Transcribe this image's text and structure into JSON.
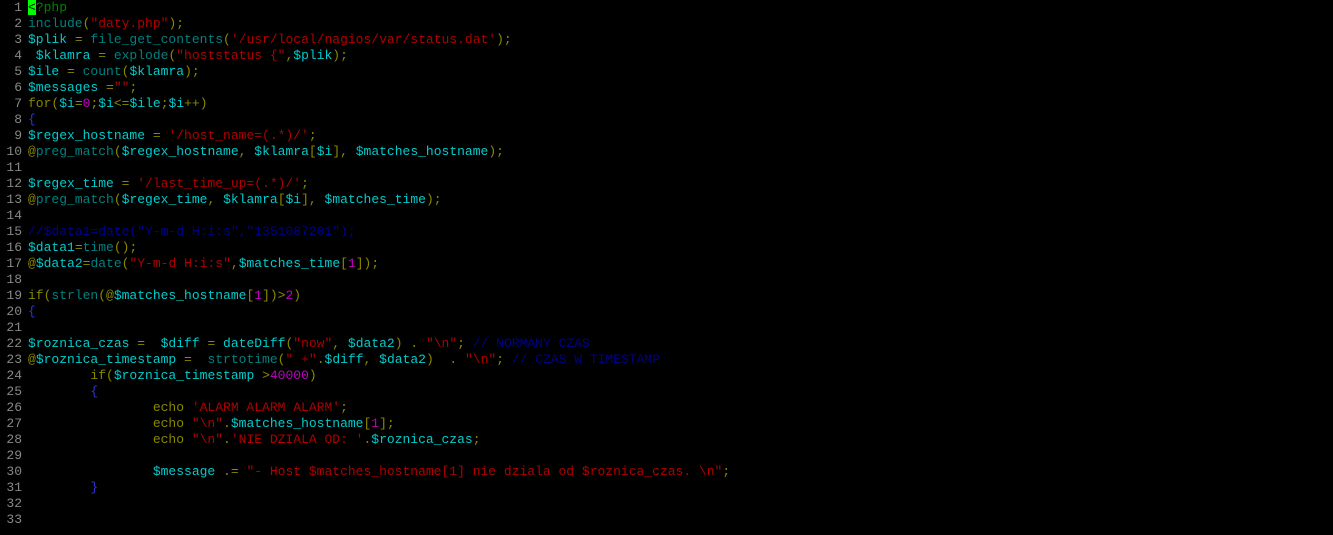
{
  "lines": [
    {
      "n": 1,
      "tokens": [
        {
          "cls": "cursor",
          "txt": "<"
        },
        {
          "cls": "tok-php",
          "txt": "?php"
        }
      ]
    },
    {
      "n": 2,
      "tokens": [
        {
          "cls": "tok-kw",
          "txt": "include"
        },
        {
          "cls": "tok-op",
          "txt": "("
        },
        {
          "cls": "tok-str",
          "txt": "\"daty.php\""
        },
        {
          "cls": "tok-op",
          "txt": ");"
        }
      ]
    },
    {
      "n": 3,
      "tokens": [
        {
          "cls": "tok-var",
          "txt": "$plik "
        },
        {
          "cls": "tok-op",
          "txt": "= "
        },
        {
          "cls": "tok-kw",
          "txt": "file_get_contents"
        },
        {
          "cls": "tok-op",
          "txt": "("
        },
        {
          "cls": "tok-str",
          "txt": "'/usr/local/nagios/var/status.dat'"
        },
        {
          "cls": "tok-op",
          "txt": ");"
        }
      ]
    },
    {
      "n": 4,
      "tokens": [
        {
          "cls": "tok-var",
          "txt": " $klamra "
        },
        {
          "cls": "tok-op",
          "txt": "= "
        },
        {
          "cls": "tok-kw",
          "txt": "explode"
        },
        {
          "cls": "tok-op",
          "txt": "("
        },
        {
          "cls": "tok-str",
          "txt": "\"hoststatus {\""
        },
        {
          "cls": "tok-op",
          "txt": ","
        },
        {
          "cls": "tok-var",
          "txt": "$plik"
        },
        {
          "cls": "tok-op",
          "txt": ");"
        }
      ]
    },
    {
      "n": 5,
      "tokens": [
        {
          "cls": "tok-var",
          "txt": "$ile "
        },
        {
          "cls": "tok-op",
          "txt": "= "
        },
        {
          "cls": "tok-kw",
          "txt": "count"
        },
        {
          "cls": "tok-op",
          "txt": "("
        },
        {
          "cls": "tok-var",
          "txt": "$klamra"
        },
        {
          "cls": "tok-op",
          "txt": ");"
        }
      ]
    },
    {
      "n": 6,
      "tokens": [
        {
          "cls": "tok-var",
          "txt": "$messages "
        },
        {
          "cls": "tok-op",
          "txt": "="
        },
        {
          "cls": "tok-str",
          "txt": "\"\""
        },
        {
          "cls": "tok-op",
          "txt": ";"
        }
      ]
    },
    {
      "n": 7,
      "tokens": [
        {
          "cls": "tok-op",
          "txt": "for("
        },
        {
          "cls": "tok-var",
          "txt": "$i"
        },
        {
          "cls": "tok-op",
          "txt": "="
        },
        {
          "cls": "tok-num",
          "txt": "0"
        },
        {
          "cls": "tok-op",
          "txt": ";"
        },
        {
          "cls": "tok-var",
          "txt": "$i"
        },
        {
          "cls": "tok-op",
          "txt": "<="
        },
        {
          "cls": "tok-var",
          "txt": "$ile"
        },
        {
          "cls": "tok-op",
          "txt": ";"
        },
        {
          "cls": "tok-var",
          "txt": "$i"
        },
        {
          "cls": "tok-op",
          "txt": "++)"
        }
      ]
    },
    {
      "n": 8,
      "tokens": [
        {
          "cls": "tok-brace",
          "txt": "{"
        }
      ]
    },
    {
      "n": 9,
      "tokens": [
        {
          "cls": "tok-var",
          "txt": "$regex_hostname "
        },
        {
          "cls": "tok-op",
          "txt": "= "
        },
        {
          "cls": "tok-str",
          "txt": "'/host_name=(.*)/'"
        },
        {
          "cls": "tok-op",
          "txt": ";"
        }
      ]
    },
    {
      "n": 10,
      "tokens": [
        {
          "cls": "tok-op",
          "txt": "@"
        },
        {
          "cls": "tok-kw",
          "txt": "preg_match"
        },
        {
          "cls": "tok-op",
          "txt": "("
        },
        {
          "cls": "tok-var",
          "txt": "$regex_hostname"
        },
        {
          "cls": "tok-op",
          "txt": ", "
        },
        {
          "cls": "tok-var",
          "txt": "$klamra"
        },
        {
          "cls": "tok-op",
          "txt": "["
        },
        {
          "cls": "tok-var",
          "txt": "$i"
        },
        {
          "cls": "tok-op",
          "txt": "], "
        },
        {
          "cls": "tok-var",
          "txt": "$matches_hostname"
        },
        {
          "cls": "tok-op",
          "txt": ");"
        }
      ]
    },
    {
      "n": 11,
      "tokens": []
    },
    {
      "n": 12,
      "tokens": [
        {
          "cls": "tok-var",
          "txt": "$regex_time "
        },
        {
          "cls": "tok-op",
          "txt": "= "
        },
        {
          "cls": "tok-str",
          "txt": "'/last_time_up=(.*)/'"
        },
        {
          "cls": "tok-op",
          "txt": ";"
        }
      ]
    },
    {
      "n": 13,
      "tokens": [
        {
          "cls": "tok-op",
          "txt": "@"
        },
        {
          "cls": "tok-kw",
          "txt": "preg_match"
        },
        {
          "cls": "tok-op",
          "txt": "("
        },
        {
          "cls": "tok-var",
          "txt": "$regex_time"
        },
        {
          "cls": "tok-op",
          "txt": ", "
        },
        {
          "cls": "tok-var",
          "txt": "$klamra"
        },
        {
          "cls": "tok-op",
          "txt": "["
        },
        {
          "cls": "tok-var",
          "txt": "$i"
        },
        {
          "cls": "tok-op",
          "txt": "], "
        },
        {
          "cls": "tok-var",
          "txt": "$matches_time"
        },
        {
          "cls": "tok-op",
          "txt": ");"
        }
      ]
    },
    {
      "n": 14,
      "tokens": []
    },
    {
      "n": 15,
      "tokens": [
        {
          "cls": "tok-comment",
          "txt": "//$data1=date(\"Y-m-d H:i:s\",\"1351087201\");"
        }
      ]
    },
    {
      "n": 16,
      "tokens": [
        {
          "cls": "tok-var",
          "txt": "$data1"
        },
        {
          "cls": "tok-op",
          "txt": "="
        },
        {
          "cls": "tok-kw",
          "txt": "time"
        },
        {
          "cls": "tok-op",
          "txt": "();"
        }
      ]
    },
    {
      "n": 17,
      "tokens": [
        {
          "cls": "tok-op",
          "txt": "@"
        },
        {
          "cls": "tok-var",
          "txt": "$data2"
        },
        {
          "cls": "tok-op",
          "txt": "="
        },
        {
          "cls": "tok-kw",
          "txt": "date"
        },
        {
          "cls": "tok-op",
          "txt": "("
        },
        {
          "cls": "tok-str",
          "txt": "\"Y-m-d H:i:s\""
        },
        {
          "cls": "tok-op",
          "txt": ","
        },
        {
          "cls": "tok-var",
          "txt": "$matches_time"
        },
        {
          "cls": "tok-op",
          "txt": "["
        },
        {
          "cls": "tok-num",
          "txt": "1"
        },
        {
          "cls": "tok-op",
          "txt": "]);"
        }
      ]
    },
    {
      "n": 18,
      "tokens": []
    },
    {
      "n": 19,
      "tokens": [
        {
          "cls": "tok-op",
          "txt": "if("
        },
        {
          "cls": "tok-kw",
          "txt": "strlen"
        },
        {
          "cls": "tok-op",
          "txt": "(@"
        },
        {
          "cls": "tok-var",
          "txt": "$matches_hostname"
        },
        {
          "cls": "tok-op",
          "txt": "["
        },
        {
          "cls": "tok-num",
          "txt": "1"
        },
        {
          "cls": "tok-op",
          "txt": "])>"
        },
        {
          "cls": "tok-num",
          "txt": "2"
        },
        {
          "cls": "tok-op",
          "txt": ")"
        }
      ]
    },
    {
      "n": 20,
      "tokens": [
        {
          "cls": "tok-brace",
          "txt": "{"
        }
      ]
    },
    {
      "n": 21,
      "tokens": []
    },
    {
      "n": 22,
      "tokens": [
        {
          "cls": "tok-var",
          "txt": "$roznica_czas "
        },
        {
          "cls": "tok-op",
          "txt": "=  "
        },
        {
          "cls": "tok-var",
          "txt": "$diff "
        },
        {
          "cls": "tok-op",
          "txt": "= "
        },
        {
          "cls": "tok-var",
          "txt": "dateDiff"
        },
        {
          "cls": "tok-op",
          "txt": "("
        },
        {
          "cls": "tok-str",
          "txt": "\"now\""
        },
        {
          "cls": "tok-op",
          "txt": ", "
        },
        {
          "cls": "tok-var",
          "txt": "$data2"
        },
        {
          "cls": "tok-op",
          "txt": ") . "
        },
        {
          "cls": "tok-str",
          "txt": "\"\\n\""
        },
        {
          "cls": "tok-op",
          "txt": "; "
        },
        {
          "cls": "tok-comment",
          "txt": "// NORMANY CZAS"
        }
      ]
    },
    {
      "n": 23,
      "tokens": [
        {
          "cls": "tok-op",
          "txt": "@"
        },
        {
          "cls": "tok-var",
          "txt": "$roznica_timestamp "
        },
        {
          "cls": "tok-op",
          "txt": "=  "
        },
        {
          "cls": "tok-kw",
          "txt": "strtotime"
        },
        {
          "cls": "tok-op",
          "txt": "("
        },
        {
          "cls": "tok-str",
          "txt": "\" +\""
        },
        {
          "cls": "tok-op",
          "txt": "."
        },
        {
          "cls": "tok-var",
          "txt": "$diff"
        },
        {
          "cls": "tok-op",
          "txt": ", "
        },
        {
          "cls": "tok-var",
          "txt": "$data2"
        },
        {
          "cls": "tok-op",
          "txt": ")  . "
        },
        {
          "cls": "tok-str",
          "txt": "\"\\n\""
        },
        {
          "cls": "tok-op",
          "txt": "; "
        },
        {
          "cls": "tok-comment",
          "txt": "// CZAS W TIMESTAMP"
        }
      ]
    },
    {
      "n": 24,
      "tokens": [
        {
          "cls": "tok-op",
          "txt": "        if("
        },
        {
          "cls": "tok-var",
          "txt": "$roznica_timestamp "
        },
        {
          "cls": "tok-op",
          "txt": ">"
        },
        {
          "cls": "tok-num",
          "txt": "40000"
        },
        {
          "cls": "tok-op",
          "txt": ")"
        }
      ]
    },
    {
      "n": 25,
      "tokens": [
        {
          "cls": "tok-brace",
          "txt": "        {"
        }
      ]
    },
    {
      "n": 26,
      "tokens": [
        {
          "cls": "tok-special",
          "txt": "                echo "
        },
        {
          "cls": "tok-str",
          "txt": "'ALARM ALARM ALARM'"
        },
        {
          "cls": "tok-op",
          "txt": ";"
        }
      ]
    },
    {
      "n": 27,
      "tokens": [
        {
          "cls": "tok-special",
          "txt": "                echo "
        },
        {
          "cls": "tok-str",
          "txt": "\"\\n\""
        },
        {
          "cls": "tok-op",
          "txt": "."
        },
        {
          "cls": "tok-var",
          "txt": "$matches_hostname"
        },
        {
          "cls": "tok-op",
          "txt": "["
        },
        {
          "cls": "tok-num",
          "txt": "1"
        },
        {
          "cls": "tok-op",
          "txt": "];"
        }
      ]
    },
    {
      "n": 28,
      "tokens": [
        {
          "cls": "tok-special",
          "txt": "                echo "
        },
        {
          "cls": "tok-str",
          "txt": "\"\\n\""
        },
        {
          "cls": "tok-op",
          "txt": "."
        },
        {
          "cls": "tok-str",
          "txt": "'NIE DZIALA OD: '"
        },
        {
          "cls": "tok-op",
          "txt": "."
        },
        {
          "cls": "tok-var",
          "txt": "$roznica_czas"
        },
        {
          "cls": "tok-op",
          "txt": ";"
        }
      ]
    },
    {
      "n": 29,
      "tokens": []
    },
    {
      "n": 30,
      "tokens": [
        {
          "cls": "tok-var",
          "txt": "                $message "
        },
        {
          "cls": "tok-op",
          "txt": ".= "
        },
        {
          "cls": "tok-str",
          "txt": "\"- Host $matches_hostname[1] nie dziala od $roznica_czas. \\n\""
        },
        {
          "cls": "tok-op",
          "txt": ";"
        }
      ]
    },
    {
      "n": 31,
      "tokens": [
        {
          "cls": "tok-brace",
          "txt": "        }"
        }
      ]
    },
    {
      "n": 32,
      "tokens": []
    },
    {
      "n": 33,
      "tokens": []
    }
  ]
}
